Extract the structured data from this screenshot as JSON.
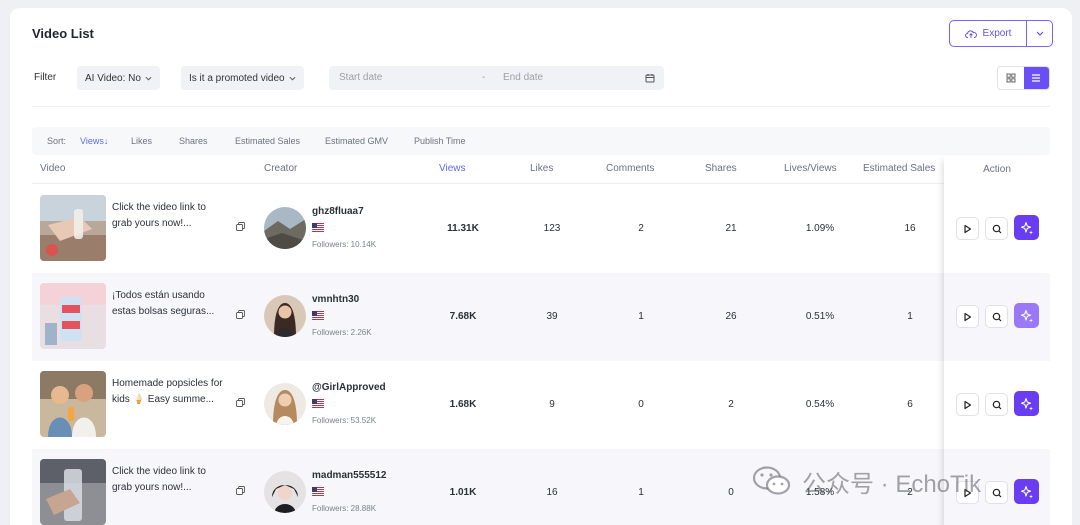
{
  "page": {
    "title": "Video List"
  },
  "export": {
    "label": "Export"
  },
  "filters": {
    "label": "Filter",
    "ai_video": "AI Video: No",
    "promoted": "Is it a promoted video",
    "start_placeholder": "Start date",
    "separator": "-",
    "end_placeholder": "End date"
  },
  "sort": {
    "label": "Sort:",
    "options": [
      "Views↓",
      "Likes",
      "Shares",
      "Estimated Sales",
      "Estimated GMV",
      "Publish Time"
    ]
  },
  "table": {
    "headers": [
      "Video",
      "Creator",
      "Views",
      "Likes",
      "Comments",
      "Shares",
      "Lives/Views",
      "Estimated Sales",
      "Action"
    ],
    "rows": [
      {
        "title": "Click the video link to grab yours now!...",
        "creator": "ghz8fluaa7",
        "followers": "Followers: 10.14K",
        "views": "11.31K",
        "likes": "123",
        "comments": "2",
        "shares": "21",
        "lives_views": "1.09%",
        "sales": "16"
      },
      {
        "title": "¡Todos están usando estas bolsas seguras...",
        "creator": "vmnhtn30",
        "followers": "Followers: 2.26K",
        "views": "7.68K",
        "likes": "39",
        "comments": "1",
        "shares": "26",
        "lives_views": "0.51%",
        "sales": "1"
      },
      {
        "title": "Homemade popsicles for kids 🍦 Easy summe...",
        "creator": "@GirlApproved",
        "followers": "Followers: 53.52K",
        "views": "1.68K",
        "likes": "9",
        "comments": "0",
        "shares": "2",
        "lives_views": "0.54%",
        "sales": "6"
      },
      {
        "title": "Click the video link to grab yours now!...",
        "creator": "madman555512",
        "followers": "Followers: 28.88K",
        "views": "1.01K",
        "likes": "16",
        "comments": "1",
        "shares": "0",
        "lives_views": "1.58%",
        "sales": "2"
      }
    ]
  },
  "watermark": {
    "text": "公众号 · EchoTik"
  },
  "colors": {
    "accent": "#6a4ff6",
    "link": "#5b6cf0",
    "ai_button": "#6a3cf2"
  },
  "icons": {
    "export": "cloud-upload-icon",
    "grid": "grid-icon",
    "list": "list-icon",
    "calendar": "calendar-icon",
    "copy": "copy-icon",
    "play": "play-icon",
    "search": "search-icon",
    "ai": "sparkle-icon",
    "flag": "us-flag-icon"
  }
}
